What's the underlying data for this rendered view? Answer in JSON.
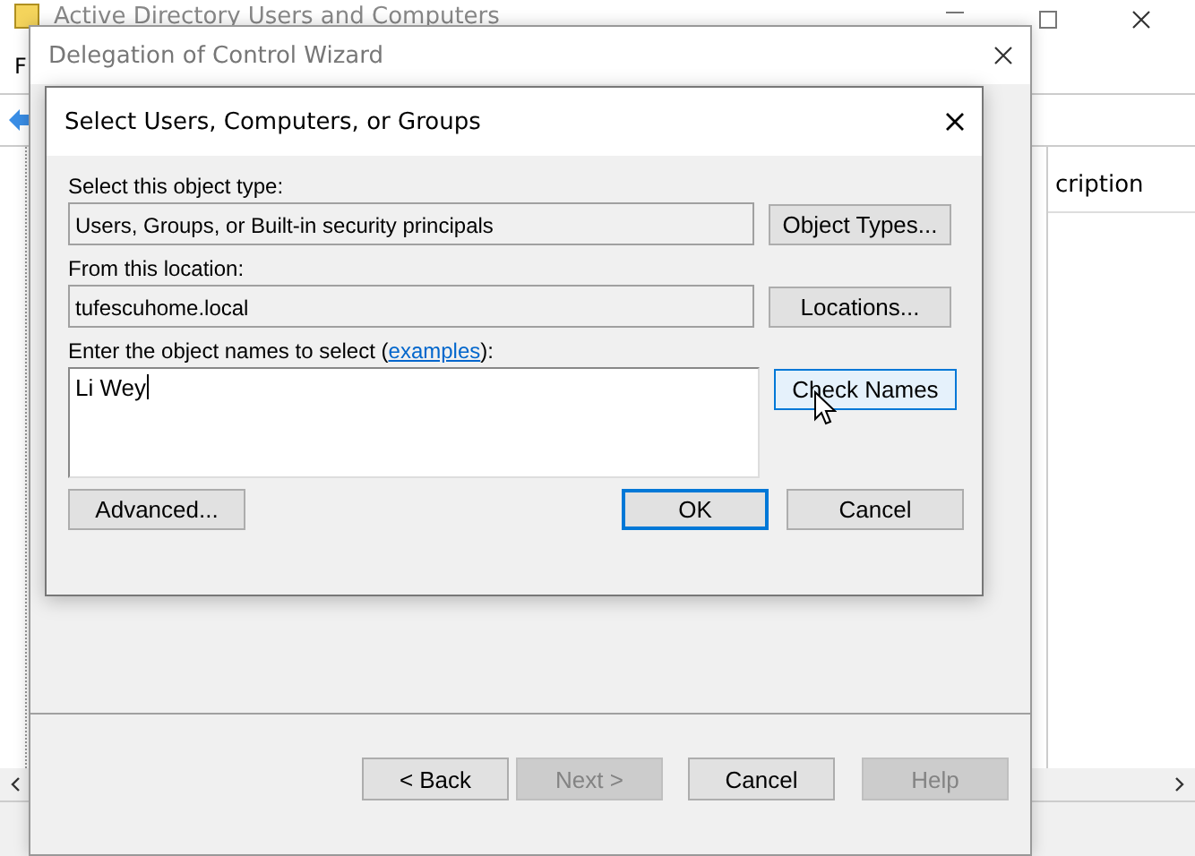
{
  "main_window": {
    "title": "Active Directory Users and Computers",
    "menu": [
      "F"
    ],
    "list_header": "cription"
  },
  "wizard": {
    "title": "Delegation of Control Wizard",
    "buttons": [
      {
        "label": "< Back",
        "disabled": false
      },
      {
        "label": "Next >",
        "disabled": true
      },
      {
        "label": "Cancel",
        "disabled": false
      },
      {
        "label": "Help",
        "disabled": true
      }
    ]
  },
  "dialog": {
    "title": "Select Users, Computers, or Groups",
    "object_type": {
      "label": "Select this object type:",
      "value": "Users, Groups, or Built-in security principals",
      "button": "Object Types..."
    },
    "location": {
      "label": "From this location:",
      "value": "tufescuhome.local",
      "button": "Locations..."
    },
    "names": {
      "label": "Enter the object names to select (",
      "link": "examples",
      "label_end": "):",
      "value": "Li Wey",
      "button": "Check Names",
      "button_hovered": true
    },
    "buttons": [
      {
        "label": "Advanced...",
        "default": false
      },
      {
        "label": "OK",
        "default": true
      },
      {
        "label": "Cancel",
        "default": false
      }
    ]
  }
}
